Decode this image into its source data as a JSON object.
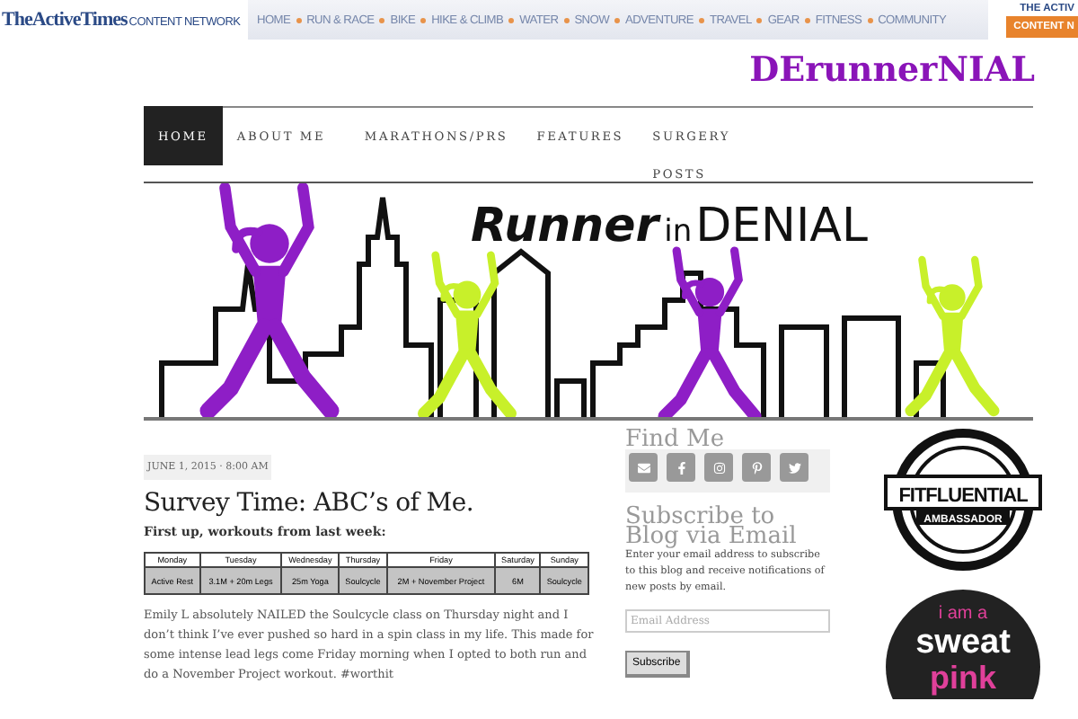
{
  "network_bar": {
    "logo_brand": "TheActiveTimes",
    "logo_suffix": "CONTENT NETWORK",
    "links": [
      "HOME",
      "RUN & RACE",
      "BIKE",
      "HIKE & CLIMB",
      "WATER",
      "SNOW",
      "ADVENTURE",
      "TRAVEL",
      "GEAR",
      "FITNESS",
      "COMMUNITY"
    ],
    "corner_label": "THE ACTIV",
    "corner_button": "CONTENT N"
  },
  "blog_title": "DErunnerNIAL",
  "nav": [
    {
      "label": "HOME",
      "selected": true
    },
    {
      "label": "ABOUT ME",
      "selected": false
    },
    {
      "label": "MARATHONS/PRS",
      "selected": false
    },
    {
      "label": "FEATURES",
      "selected": false
    },
    {
      "label": "SURGERY POSTS",
      "selected": false
    }
  ],
  "banner": {
    "script": "Runner",
    "small": "in",
    "caps": "DENIAL"
  },
  "post": {
    "date": "JUNE 1, 2015 · 8:00 AM",
    "title": "Survey Time: ABC’s of Me.",
    "intro": "First up, workouts from last week:",
    "table": {
      "columns": [
        "Monday",
        "Tuesday",
        "Wednesday",
        "Thursday",
        "Friday",
        "Saturday",
        "Sunday"
      ],
      "rows": [
        [
          "Active Rest",
          "3.1M + 20m Legs",
          "25m Yoga",
          "Soulcycle",
          "2M + November Project",
          "6M",
          "Soulcycle"
        ]
      ]
    },
    "body": "Emily L absolutely NAILED the Soulcycle class on Thursday night and I don’t think I’ve ever pushed so hard in a spin class in my life. This made for some intense lead legs come Friday morning when I opted to both run and do a November Project workout.  #worthit"
  },
  "sidebar": {
    "find_me": "Find Me",
    "social": [
      {
        "kind": "mail"
      },
      {
        "kind": "facebook"
      },
      {
        "kind": "instagram"
      },
      {
        "kind": "pinterest"
      },
      {
        "kind": "twitter"
      }
    ],
    "subscribe_title": "Subscribe to Blog via Email",
    "subscribe_text": "Enter your email address to subscribe to this blog and receive notifications of new posts by email.",
    "email": {
      "placeholder": "Email Address"
    },
    "subscribe_button": "Subscribe"
  },
  "badges": [
    {
      "kind": "ring",
      "lines": [
        "FITFLUENTIAL",
        "AMBASSADOR"
      ]
    },
    {
      "kind": "disc",
      "lines": [
        "i am a",
        "sweat",
        "pink"
      ]
    }
  ]
}
